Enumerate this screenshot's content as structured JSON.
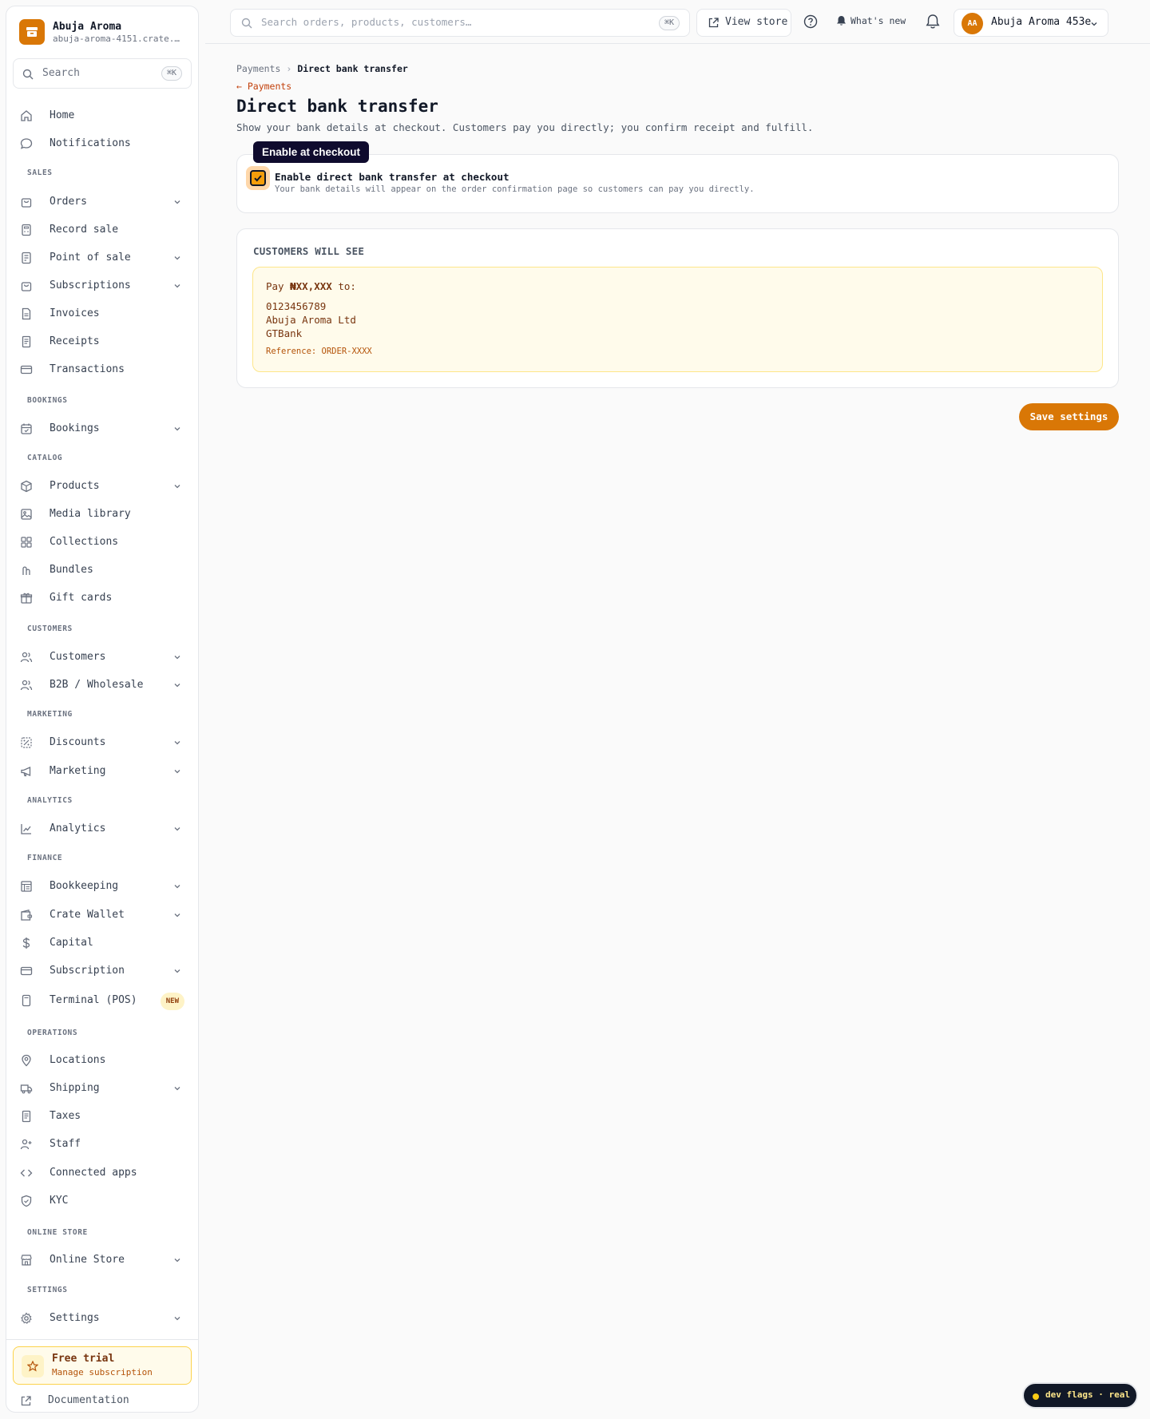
{
  "brand": {
    "name": "Abuja Aroma",
    "subdomain": "abuja-aroma-4151.crate.t…"
  },
  "sidebar_search": {
    "placeholder": "Search",
    "shortcut": "⌘K"
  },
  "nav": {
    "home": "Home",
    "notifications": "Notifications",
    "sales_label": "SALES",
    "orders": "Orders",
    "record_sale": "Record sale",
    "point_of_sale": "Point of sale",
    "subscriptions": "Subscriptions",
    "invoices": "Invoices",
    "receipts": "Receipts",
    "transactions": "Transactions",
    "bookings_label": "BOOKINGS",
    "bookings": "Bookings",
    "catalog_label": "CATALOG",
    "products": "Products",
    "media_library": "Media library",
    "collections": "Collections",
    "bundles": "Bundles",
    "gift_cards": "Gift cards",
    "customers_label": "CUSTOMERS",
    "customers": "Customers",
    "b2b": "B2B / Wholesale",
    "marketing_label": "MARKETING",
    "discounts": "Discounts",
    "marketing": "Marketing",
    "analytics_label": "ANALYTICS",
    "analytics": "Analytics",
    "finance_label": "FINANCE",
    "bookkeeping": "Bookkeeping",
    "crate_wallet": "Crate Wallet",
    "capital": "Capital",
    "subscription": "Subscription",
    "terminal": "Terminal (POS)",
    "terminal_badge": "NEW",
    "operations_label": "OPERATIONS",
    "locations": "Locations",
    "shipping": "Shipping",
    "taxes": "Taxes",
    "staff": "Staff",
    "connected_apps": "Connected apps",
    "kyc": "KYC",
    "online_store_label": "ONLINE STORE",
    "online_store": "Online Store",
    "settings_label": "SETTINGS",
    "settings": "Settings"
  },
  "trial": {
    "title": "Free trial",
    "subtitle": "Manage subscription"
  },
  "documentation": "Documentation",
  "topbar": {
    "search_placeholder": "Search orders, products, customers…",
    "search_shortcut": "⌘K",
    "view_store": "View store",
    "whats_new": "What's new",
    "account_initials": "AA",
    "account_name": "Abuja Aroma 453e"
  },
  "page": {
    "breadcrumb_parent": "Payments",
    "breadcrumb_current": "Direct bank transfer",
    "back_link": "← Payments",
    "title": "Direct bank transfer",
    "description": "Show your bank details at checkout. Customers pay you directly; you confirm receipt and fulfill.",
    "tooltip": "Enable at checkout",
    "enable_label": "Enable direct bank transfer at checkout",
    "enable_description": "Your bank details will appear on the order confirmation page so customers can pay you directly.",
    "enabled": true,
    "preview_heading": "CUSTOMERS WILL SEE",
    "pay_prefix": "Pay ",
    "pay_amount": "₦XX,XXX",
    "pay_suffix": " to:",
    "account_number": "0123456789",
    "account_name": "Abuja Aroma Ltd",
    "bank_name": "GTBank",
    "reference": "Reference: ORDER-XXXX",
    "save_button": "Save settings"
  },
  "dev_flags": "dev flags · real",
  "colors": {
    "accent": "#d97706",
    "preview_bg": "#fffbeb",
    "tooltip_bg": "#0f0b2e"
  }
}
